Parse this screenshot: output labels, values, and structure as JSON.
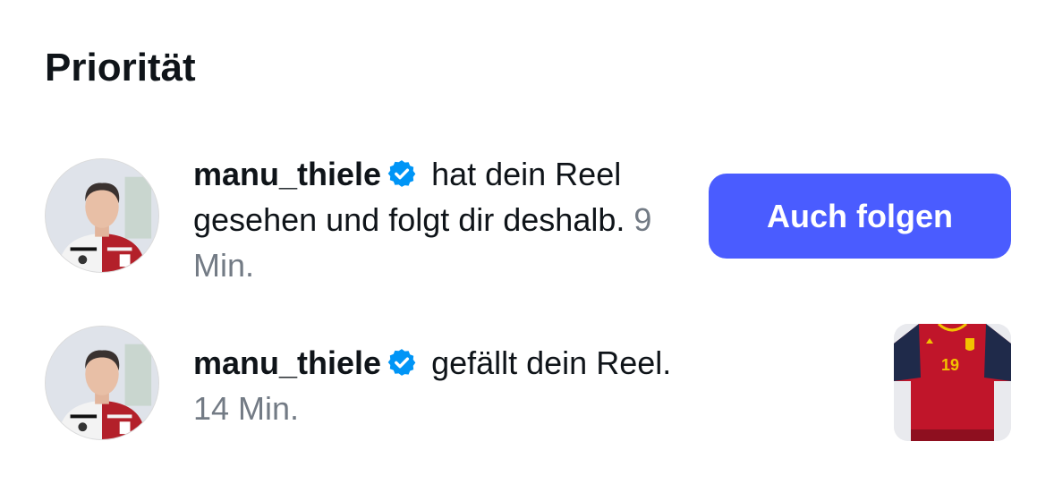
{
  "section": {
    "title": "Priorität"
  },
  "notifications": [
    {
      "username": "manu_thiele",
      "verified": true,
      "action": " hat dein Reel gesehen und folgt dir deshalb. ",
      "time": "9 Min.",
      "follow_button_label": "Auch folgen",
      "avatar_icon": "profile-photo"
    },
    {
      "username": "manu_thiele",
      "verified": true,
      "action": " gefällt dein Reel. ",
      "time": "14 Min.",
      "thumbnail_icon": "reel-thumbnail-spain-jersey-19",
      "thumbnail_number": "19",
      "avatar_icon": "profile-photo"
    }
  ],
  "colors": {
    "accent": "#4a5cff",
    "verified_badge": "#0095f6",
    "timestamp": "#737b85"
  }
}
